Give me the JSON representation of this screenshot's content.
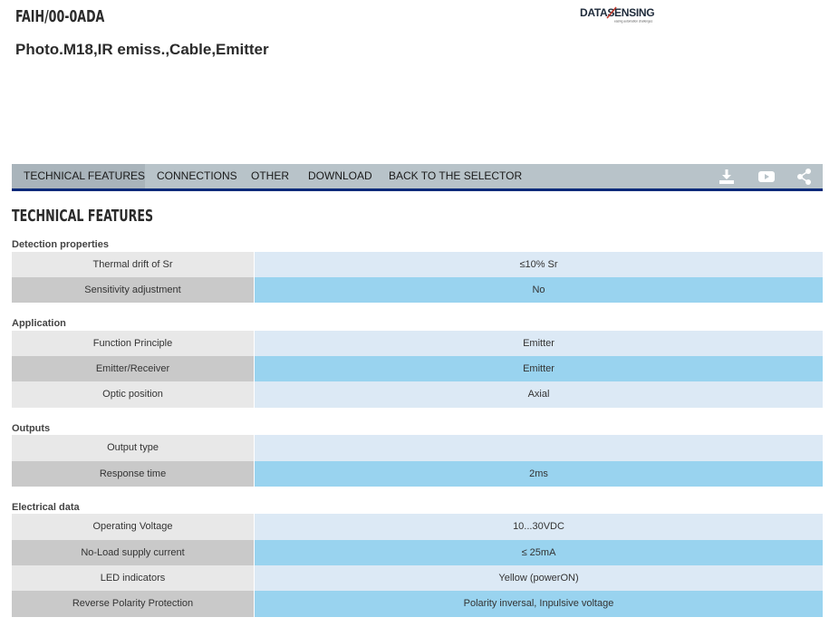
{
  "header": {
    "product_code": "FAIH/00-0ADA",
    "product_desc": "Photo.M18,IR emiss.,Cable,Emitter",
    "logo_text": "DATASENSING",
    "logo_tagline": "easing automation challenges"
  },
  "tabs": [
    {
      "label": "TECHNICAL FEATURES",
      "active": true
    },
    {
      "label": "CONNECTIONS",
      "active": false
    },
    {
      "label": "OTHER",
      "active": false
    },
    {
      "label": "DOWNLOAD",
      "active": false
    },
    {
      "label": "BACK TO THE SELECTOR",
      "active": false
    }
  ],
  "tab_icons": [
    "download-icon",
    "youtube-icon",
    "share-icon"
  ],
  "colors": {
    "accent": "#0a2a7a",
    "tabbar": "#b8c3c9",
    "row_light_label": "#e8e8e8",
    "row_light_value": "#dce9f5",
    "row_dark_label": "#c9c9c9",
    "row_dark_value": "#99d3ef"
  },
  "section_heading": "TECHNICAL FEATURES",
  "groups": [
    {
      "title": "Detection properties",
      "rows": [
        {
          "label": "Thermal drift of Sr",
          "value": "≤10% Sr"
        },
        {
          "label": "Sensitivity adjustment",
          "value": "No"
        }
      ]
    },
    {
      "title": "Application",
      "rows": [
        {
          "label": "Function Principle",
          "value": "Emitter"
        },
        {
          "label": "Emitter/Receiver",
          "value": "Emitter"
        },
        {
          "label": "Optic position",
          "value": "Axial"
        }
      ]
    },
    {
      "title": "Outputs",
      "rows": [
        {
          "label": "Output type",
          "value": ""
        },
        {
          "label": "Response time",
          "value": "2ms"
        }
      ]
    },
    {
      "title": "Electrical data",
      "rows": [
        {
          "label": "Operating Voltage",
          "value": "10...30VDC"
        },
        {
          "label": "No-Load supply current",
          "value": "≤ 25mA"
        },
        {
          "label": "LED indicators",
          "value": "Yellow (powerON)"
        },
        {
          "label": "Reverse Polarity Protection",
          "value": "Polarity inversal, Inpulsive voltage"
        }
      ]
    }
  ]
}
